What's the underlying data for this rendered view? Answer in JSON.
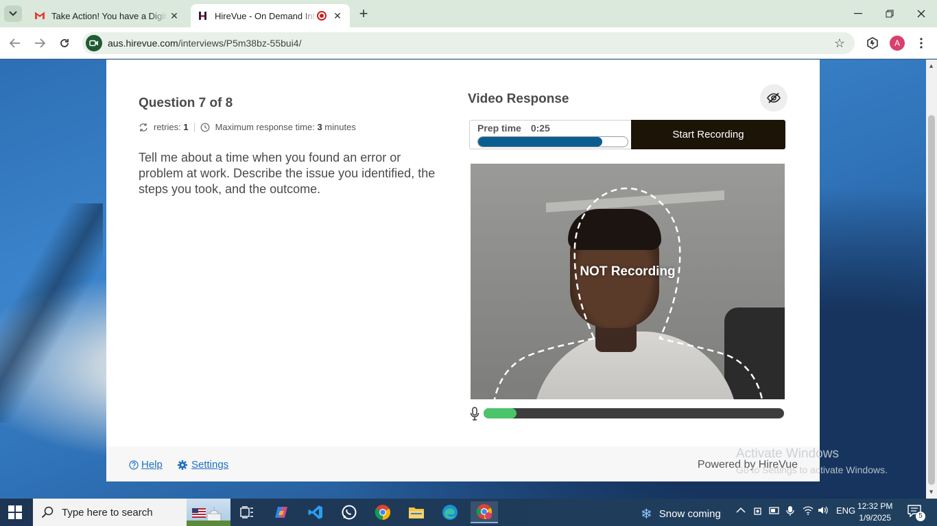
{
  "browser": {
    "tabs": [
      {
        "title": "Take Action! You have a Digital",
        "favicon": "gmail-icon",
        "active": false
      },
      {
        "title": "HireVue - On Demand Interview",
        "favicon": "hirevue-icon",
        "active": true,
        "recording": true
      }
    ],
    "url_domain": "aus.hirevue.com",
    "url_path": "/interviews/P5m38bz-55bui4/",
    "profile_initial": "A"
  },
  "interview": {
    "question_title": "Question 7 of 8",
    "retries_label": "retries:",
    "retries_value": "1",
    "max_time_label": "Maximum response time:",
    "max_time_value": "3",
    "max_time_unit": "minutes",
    "question_text": "Tell me about a time when you found an error or problem at work. Describe the issue you identified, the steps you took, and the outcome.",
    "video_title": "Video Response",
    "prep_label": "Prep time",
    "prep_time": "0:25",
    "prep_progress": 0.83,
    "start_label": "Start Recording",
    "status_overlay": "NOT Recording",
    "mic_level": 0.11
  },
  "footer": {
    "help_label": "Help",
    "settings_label": "Settings",
    "powered_by": "Powered by HireVue"
  },
  "watermark": {
    "line1": "Activate Windows",
    "line2": "Go to Settings to activate Windows."
  },
  "taskbar": {
    "search_placeholder": "Type here to search",
    "weather": "Snow coming",
    "language": "ENG",
    "time": "12:32 PM",
    "date": "1/9/2025",
    "notification_count": "5"
  }
}
